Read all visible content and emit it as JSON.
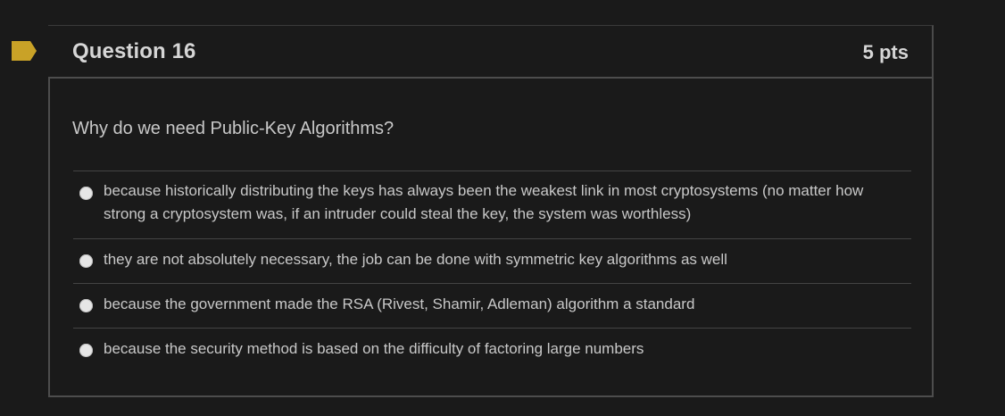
{
  "question": {
    "title": "Question 16",
    "points": "5 pts",
    "prompt": "Why do we need Public-Key Algorithms?",
    "flag_color": "#c9a227",
    "answers": [
      {
        "label": "because historically distributing the keys has always been the weakest link in most cryptosystems (no matter how strong a cryptosystem was, if an intruder could steal the key, the system was worthless)"
      },
      {
        "label": "they are not absolutely necessary, the job can be done with symmetric key algorithms as well"
      },
      {
        "label": "because the government made the RSA (Rivest, Shamir, Adleman) algorithm a standard"
      },
      {
        "label": "because the security method is based on the difficulty of factoring large numbers"
      }
    ]
  }
}
